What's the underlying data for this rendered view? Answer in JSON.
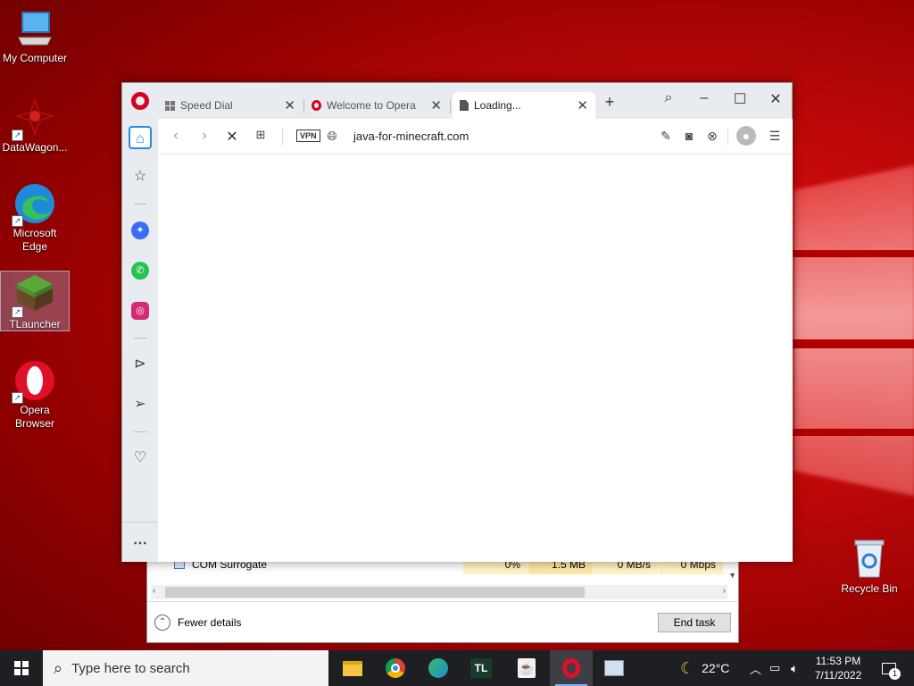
{
  "desktop": {
    "icons": [
      {
        "label": "My Computer"
      },
      {
        "label": "DataWagon..."
      },
      {
        "label": "Microsoft Edge"
      },
      {
        "label": "TLauncher"
      },
      {
        "label": "Opera Browser"
      },
      {
        "label": "Recycle Bin"
      }
    ]
  },
  "task_manager": {
    "process_name": "COM Surrogate",
    "cpu": "0%",
    "memory": "1.5 MB",
    "disk": "0 MB/s",
    "network": "0 Mbps",
    "fewer_details": "Fewer details",
    "end_task": "End task"
  },
  "opera": {
    "tabs": [
      {
        "label": "Speed Dial",
        "icon": "speed-dial-icon"
      },
      {
        "label": "Welcome to Opera",
        "icon": "opera-icon"
      },
      {
        "label": "Loading...",
        "icon": "document-icon"
      }
    ],
    "vpn_label": "VPN",
    "url": "java-for-minecraft.com"
  },
  "taskbar": {
    "search_placeholder": "Type here to search",
    "tl_label": "TL",
    "temperature": "22°C",
    "time": "11:53 PM",
    "date": "7/11/2022",
    "notification_count": "1"
  },
  "colors": {
    "opera_red": "#d70022",
    "accent_blue": "#2b8ae2",
    "taskbar": "#1e1f22"
  }
}
